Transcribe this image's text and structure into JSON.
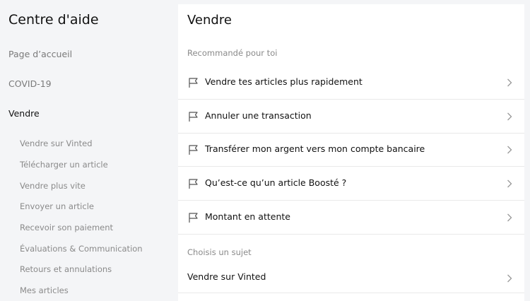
{
  "sidebar": {
    "title": "Centre d'aide",
    "top_items": [
      {
        "label": "Page d’accueil"
      },
      {
        "label": "COVID-19"
      },
      {
        "label": "Vendre"
      }
    ],
    "sub_items": [
      {
        "label": "Vendre sur Vinted"
      },
      {
        "label": "Télécharger un article"
      },
      {
        "label": "Vendre plus vite"
      },
      {
        "label": "Envoyer un article"
      },
      {
        "label": "Recevoir son paiement"
      },
      {
        "label": "Évaluations & Communication"
      },
      {
        "label": "Retours et annulations"
      },
      {
        "label": "Mes articles"
      }
    ]
  },
  "main": {
    "title": "Vendre",
    "recommended_label": "Recommandé pour toi",
    "recommended": [
      {
        "label": "Vendre tes articles plus rapidement",
        "icon": "flag-icon"
      },
      {
        "label": "Annuler une transaction",
        "icon": "flag-icon"
      },
      {
        "label": "Transférer mon argent vers mon compte bancaire",
        "icon": "flag-icon"
      },
      {
        "label": "Qu’est-ce qu’un article Boosté ?",
        "icon": "flag-icon"
      },
      {
        "label": "Montant en attente",
        "icon": "flag-icon"
      }
    ],
    "topics_label": "Choisis un sujet",
    "topics": [
      {
        "label": "Vendre sur Vinted"
      }
    ]
  }
}
